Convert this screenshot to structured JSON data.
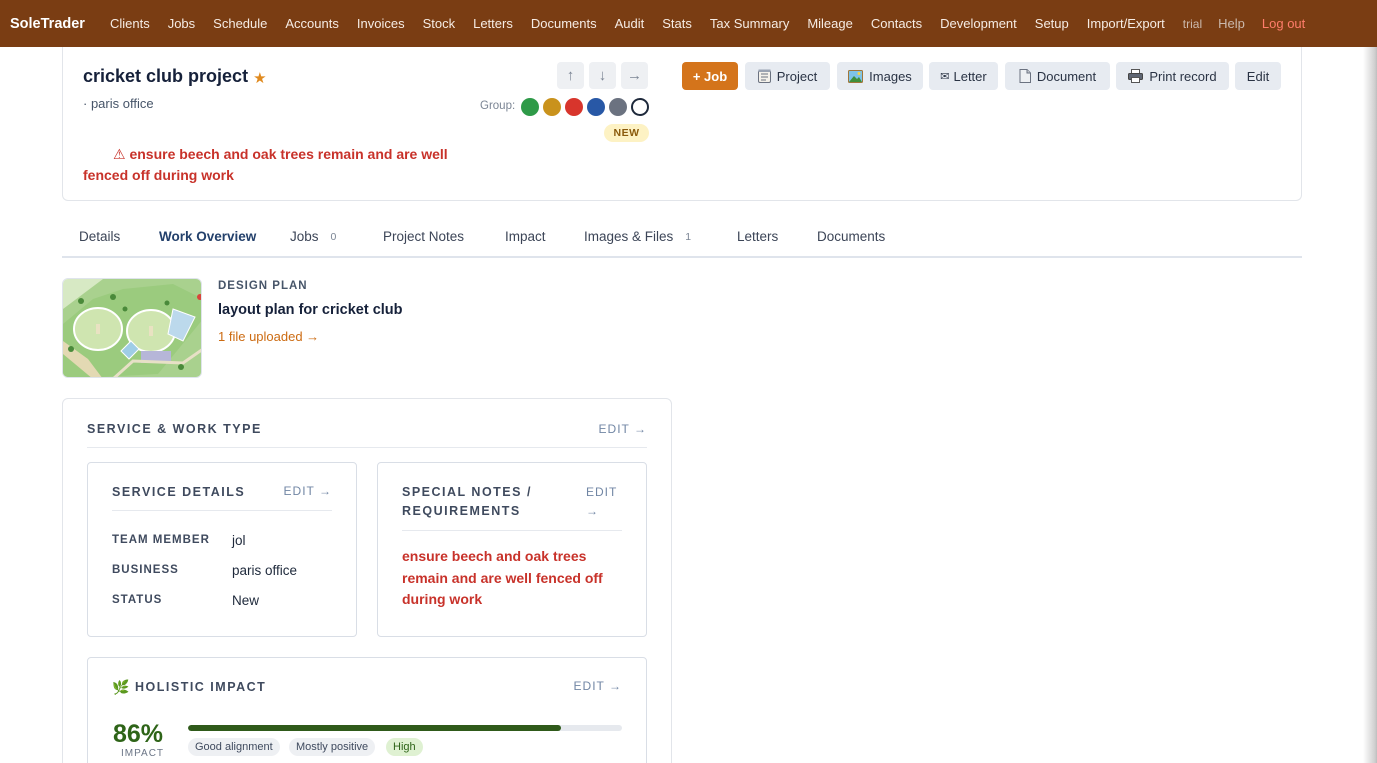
{
  "nav": {
    "brand": "SoleTrader",
    "links": [
      "Clients",
      "Jobs",
      "Schedule",
      "Accounts",
      "Invoices",
      "Stock",
      "Letters",
      "Documents",
      "Audit",
      "Stats",
      "Tax Summary",
      "Mileage",
      "Contacts",
      "Development",
      "Setup",
      "Import/Export"
    ],
    "trial": "trial",
    "help": "Help",
    "logout": "Log out"
  },
  "project": {
    "title": "cricket club project",
    "subtitle": "· paris office",
    "warning": "⚠ ensure beech and oak trees remain and are well fenced off during work",
    "group_label": "Group:",
    "group_colors": [
      "#2e9a48",
      "#c9921c",
      "#d8352c",
      "#2858a6",
      "#6b7280",
      "#ffffff"
    ],
    "status_badge": "NEW",
    "star_color": "#e08a1e"
  },
  "toolbar": {
    "up_icon": "↑",
    "down_icon": "↓",
    "next_icon": "→",
    "add_job": "+ Job",
    "project": "Project",
    "images": "Images",
    "letter_glyph": "✉",
    "letter": "Letter",
    "document": "Document",
    "print": "Print record",
    "edit": "Edit"
  },
  "tabs": [
    {
      "label": "Details"
    },
    {
      "label": "Work Overview",
      "active": true
    },
    {
      "label": "Jobs",
      "count": "0"
    },
    {
      "label": "Project Notes"
    },
    {
      "label": "Impact"
    },
    {
      "label": "Images & Files",
      "count": "1"
    },
    {
      "label": "Letters"
    },
    {
      "label": "Documents"
    }
  ],
  "design_plan": {
    "label": "DESIGN PLAN",
    "title": "layout plan for cricket club",
    "link": "1 file uploaded →"
  },
  "service_panel": {
    "title": "SERVICE & WORK TYPE",
    "edit": "EDIT →",
    "service_details": {
      "title": "SERVICE DETAILS",
      "edit": "EDIT →",
      "rows": [
        {
          "key": "TEAM MEMBER",
          "value": "jol"
        },
        {
          "key": "BUSINESS",
          "value": "paris office"
        },
        {
          "key": "STATUS",
          "value": "New"
        }
      ]
    },
    "special_notes": {
      "title_line1": "SPECIAL NOTES /",
      "title_line2": "REQUIREMENTS",
      "edit_line1": "EDIT",
      "edit_line2": "→",
      "text": "ensure beech and oak trees remain and are well fenced off during work"
    },
    "holistic": {
      "icon": "🌿",
      "title": "HOLISTIC IMPACT",
      "edit": "EDIT →",
      "percent_text": "86%",
      "percent_value": 86,
      "label": "IMPACT",
      "chips": [
        "Good alignment",
        "Mostly positive",
        "High"
      ]
    }
  },
  "colors": {
    "nav_bg": "#7a3d13",
    "accent": "#d4741b",
    "warning": "#c8322a",
    "impact": "#2e6418"
  }
}
